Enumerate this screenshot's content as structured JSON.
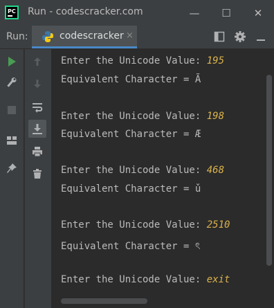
{
  "window": {
    "title": "Run - codescracker.com",
    "minimize_glyph": "—",
    "maximize_glyph": "☐",
    "close_glyph": "✕"
  },
  "app_icon": {
    "name": "pycharm-icon",
    "text": "PC"
  },
  "run_panel": {
    "label": "Run:",
    "tab": {
      "label": "codescracker",
      "icon": "python-icon",
      "close_glyph": "×"
    },
    "toolbar_icons": [
      "layout-icon",
      "gear-icon",
      "minimize-icon"
    ]
  },
  "left_gutter_icons": [
    "run-icon",
    "wrench-icon",
    "stop-icon",
    "layout-icon",
    "pin-icon"
  ],
  "second_gutter_icons": [
    "up-arrow-icon",
    "down-arrow-icon",
    "soft-wrap-icon",
    "scroll-to-end-icon",
    "print-icon",
    "trash-icon"
  ],
  "colors": {
    "background": "#2b2b2b",
    "panel": "#3c3f41",
    "text": "#bbbbbb",
    "user_input": "#d9b24c",
    "run_green": "#499c54",
    "accent": "#4a88c7"
  },
  "console": {
    "lines": [
      {
        "text": "Enter the Unicode Value: ",
        "input": "195"
      },
      {
        "text": "Equivalent Character = Ã",
        "input": ""
      },
      {
        "text": "Enter the Unicode Value: ",
        "input": "198"
      },
      {
        "text": "Equivalent Character = Æ",
        "input": ""
      },
      {
        "text": "Enter the Unicode Value: ",
        "input": "468"
      },
      {
        "text": "Equivalent Character = ǔ",
        "input": ""
      },
      {
        "text": "Enter the Unicode Value: ",
        "input": "2510"
      },
      {
        "text": "Equivalent Character = ৎ",
        "input": ""
      },
      {
        "text": "Enter the Unicode Value: ",
        "input": "exit"
      }
    ]
  }
}
